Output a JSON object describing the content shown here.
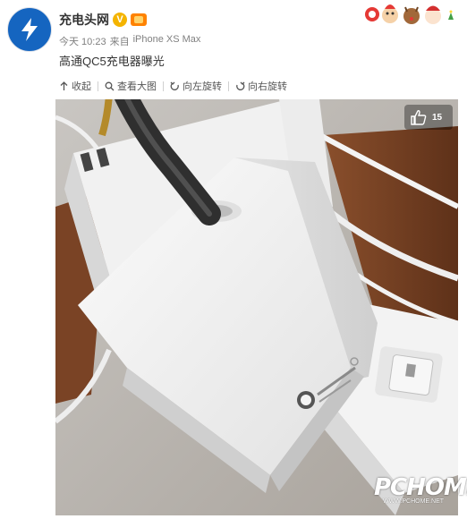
{
  "post": {
    "username": "充电头网",
    "verified_mark": "V",
    "time": "今天 10:23",
    "source_prefix": "来自",
    "source": "iPhone XS Max",
    "text": "高通QC5充电器曝光"
  },
  "toolbar": {
    "collapse": "收起",
    "view_large": "查看大图",
    "rotate_left": "向左旋转",
    "rotate_right": "向右旋转"
  },
  "image_overlay": {
    "like_count": "15"
  },
  "watermark": {
    "main": "PCHOME",
    "sub": "WWW.PCHOME.NET"
  },
  "colors": {
    "avatar_bg": "#1565c0",
    "verified": "#f4b400",
    "text_primary": "#333333",
    "text_meta": "#808080"
  }
}
